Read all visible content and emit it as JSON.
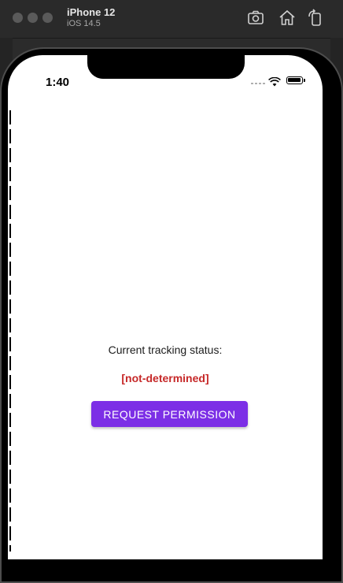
{
  "window": {
    "device_name": "iPhone 12",
    "os_version": "iOS 14.5"
  },
  "status_bar": {
    "time": "1:40"
  },
  "app": {
    "tracking_label": "Current tracking status:",
    "tracking_value": "[not-determined]",
    "request_button_label": "REQUEST PERMISSION"
  },
  "colors": {
    "accent": "#7c2fe6",
    "status_value": "#c62828"
  },
  "icons": {
    "screenshot": "camera-icon",
    "home": "home-icon",
    "rotate": "rotate-icon",
    "wifi": "wifi-icon",
    "battery": "battery-icon"
  }
}
